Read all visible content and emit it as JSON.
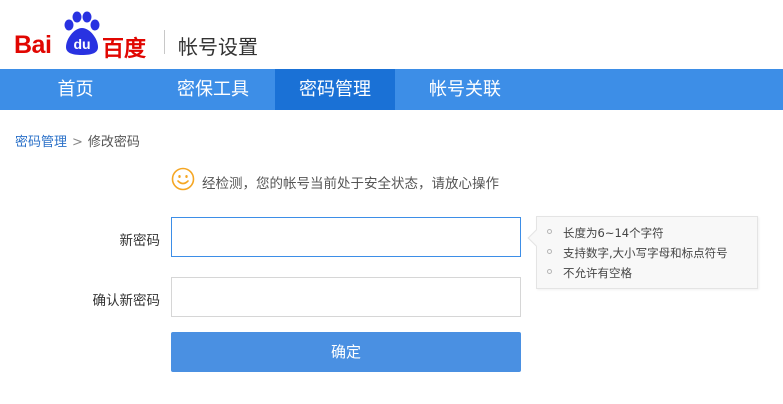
{
  "header": {
    "logo_text_left": "Bai",
    "logo_paw_text": "du",
    "logo_text_right": "百度",
    "title": "帐号设置"
  },
  "nav": {
    "items": [
      {
        "label": "首页",
        "active": false
      },
      {
        "label": "密保工具",
        "active": false
      },
      {
        "label": "密码管理",
        "active": true
      },
      {
        "label": "帐号关联",
        "active": false
      }
    ]
  },
  "breadcrumb": {
    "parent": "密码管理",
    "separator": ">",
    "current": "修改密码"
  },
  "notice": {
    "icon": "smiley-icon",
    "text": "经检测，您的帐号当前处于安全状态，请放心操作"
  },
  "form": {
    "new_password": {
      "label": "新密码",
      "value": "",
      "placeholder": ""
    },
    "confirm_password": {
      "label": "确认新密码",
      "value": "",
      "placeholder": ""
    },
    "submit_label": "确定"
  },
  "tips": [
    "长度为6~14个字符",
    "支持数字,大小写字母和标点符号",
    "不允许有空格"
  ],
  "colors": {
    "brand_red": "#e10601",
    "brand_blue": "#2932e1",
    "nav_bg": "#3d8ee7",
    "nav_active_bg": "#1a71d6",
    "button_bg": "#4a90e2",
    "smiley": "#f5a623"
  }
}
